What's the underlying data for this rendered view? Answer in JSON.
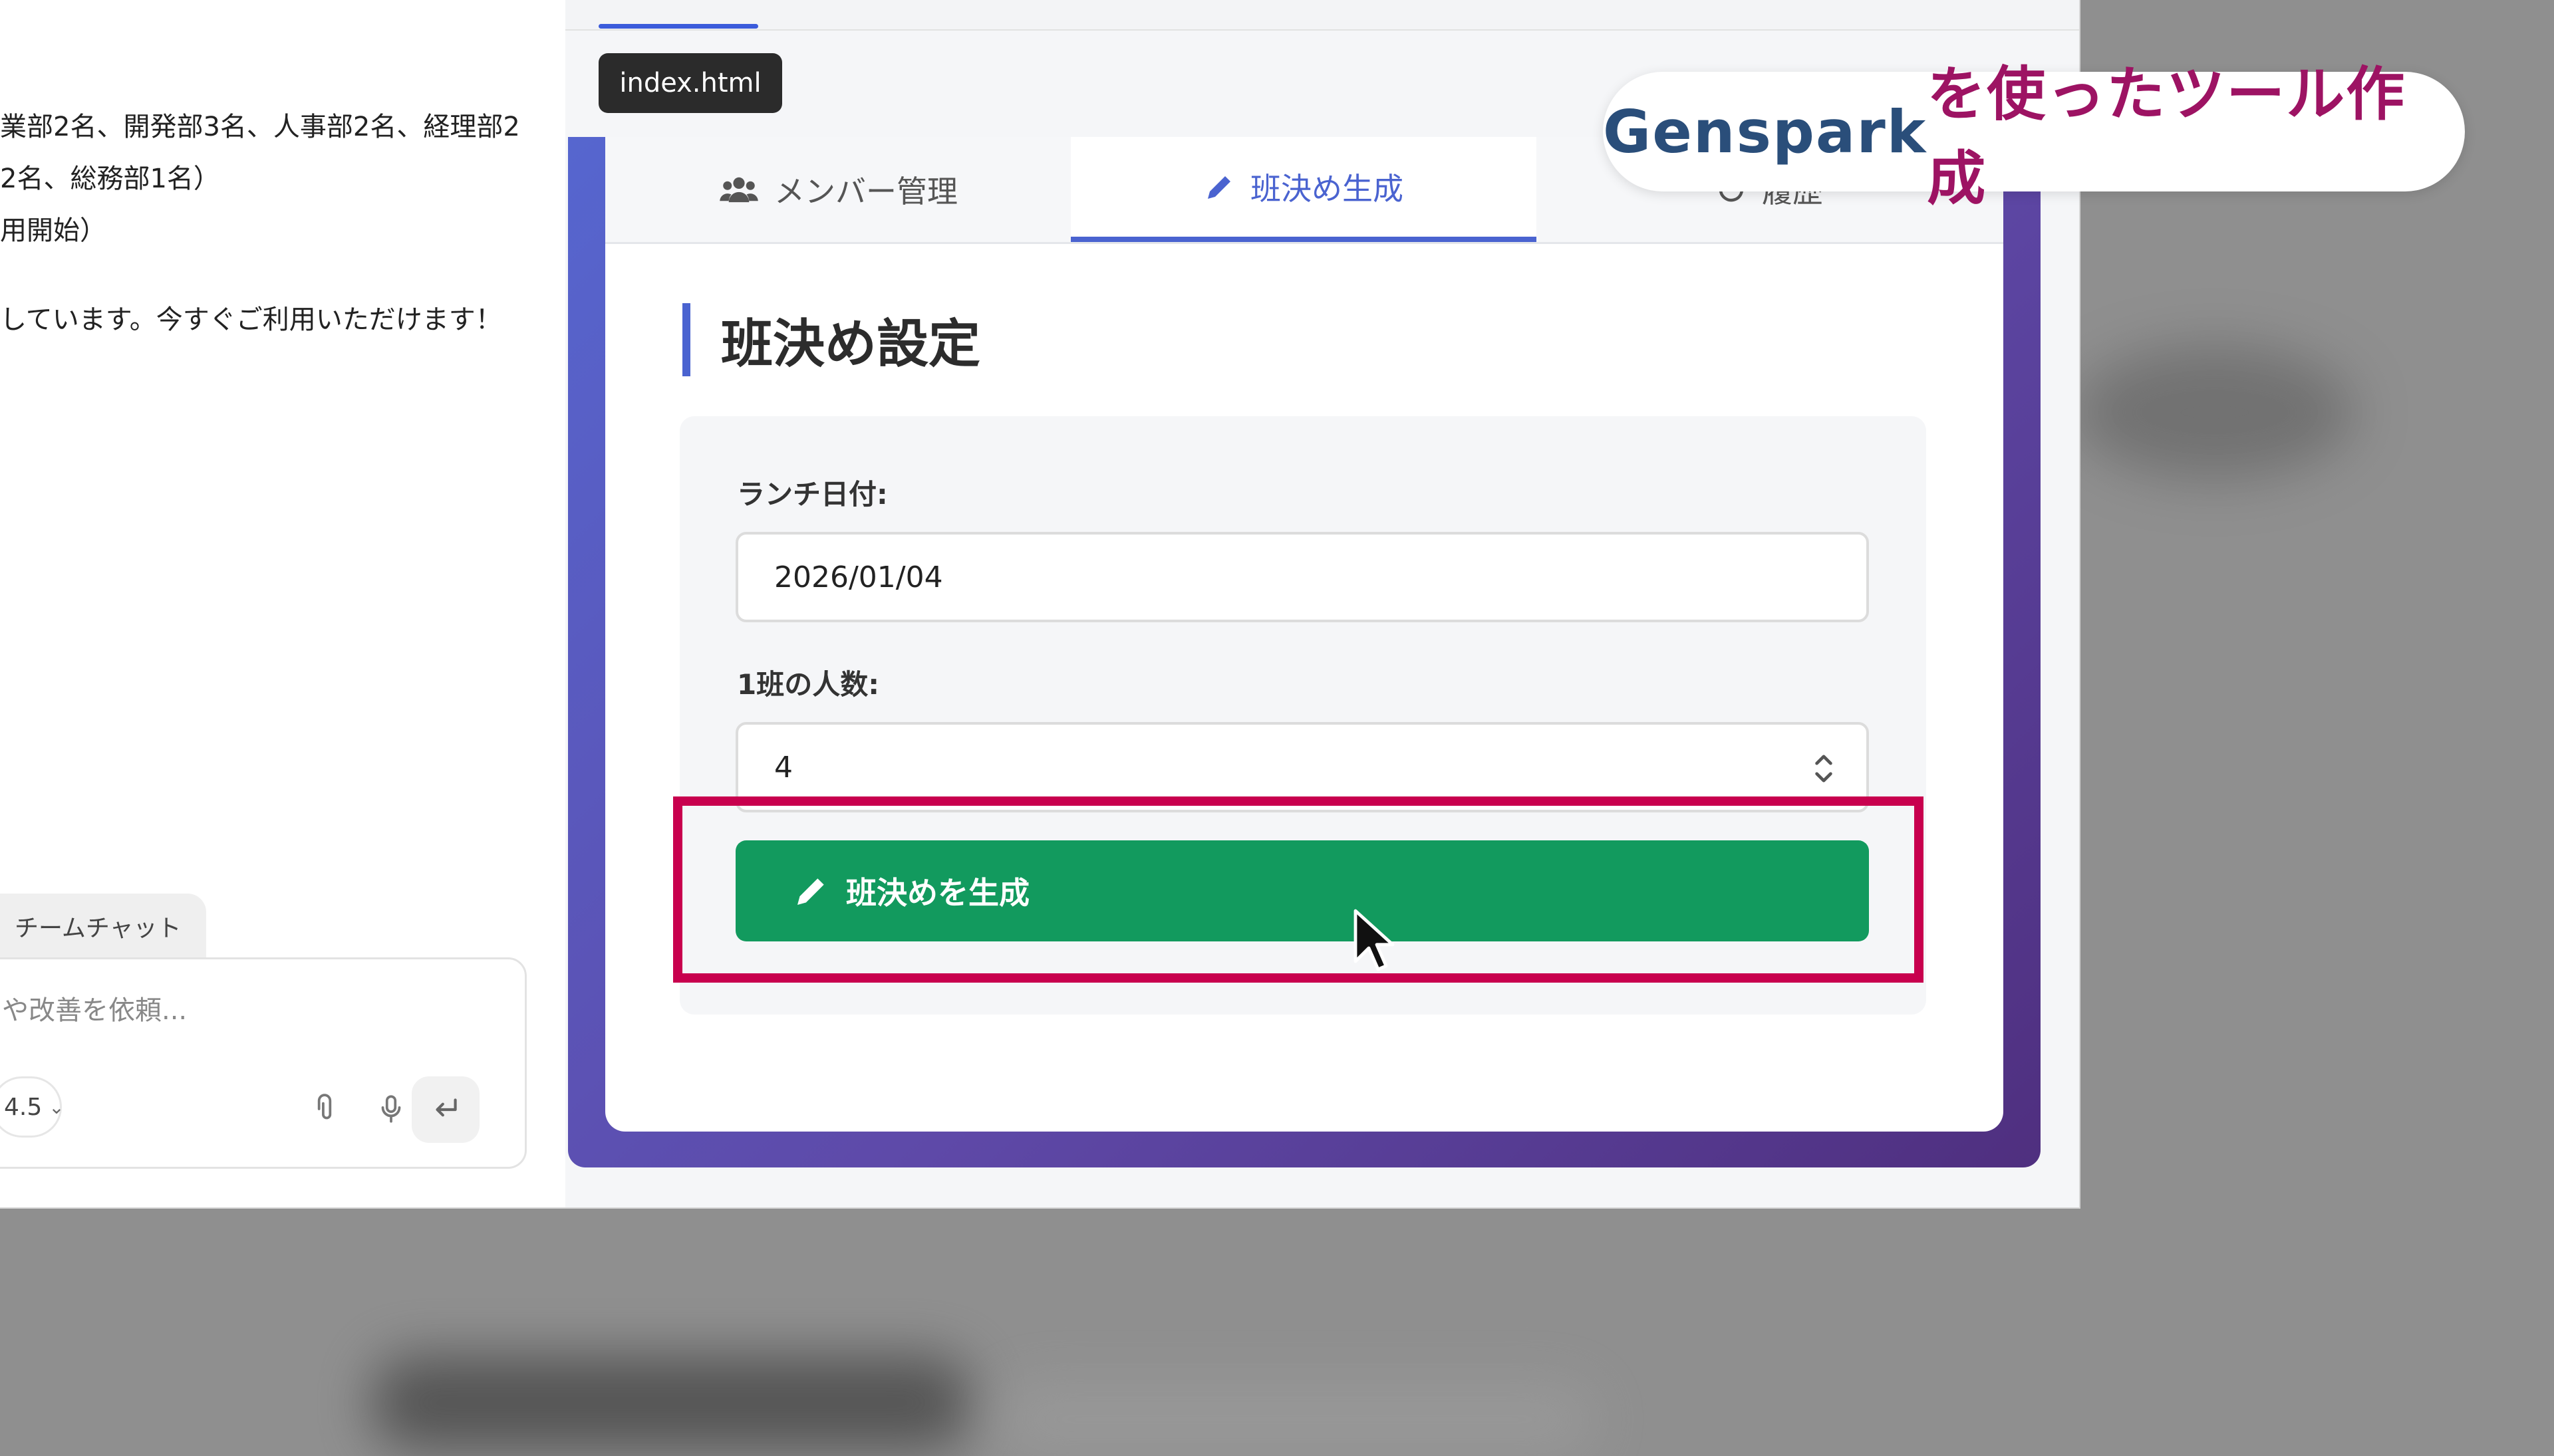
{
  "chat": {
    "lines": [
      "業部2名、開発部3名、人事部2名、経理部2",
      "2名、総務部1名）",
      "用開始）",
      "しています。今すぐご利用いただけます！"
    ],
    "tab_label": "チームチャット",
    "input_placeholder": "や改善を依頼...",
    "model_label": "4.5"
  },
  "preview": {
    "file_badge": "index.html",
    "tabs": [
      {
        "label": "メンバー管理",
        "icon": "users-icon"
      },
      {
        "label": "班決め生成",
        "icon": "pencil-icon"
      },
      {
        "label": "履歴",
        "icon": "history-icon"
      }
    ],
    "section_title": "班決め設定",
    "form": {
      "date_label": "ランチ日付:",
      "date_value": "2026/01/04",
      "group_size_label": "1班の人数:",
      "group_size_value": "4"
    },
    "generate_button_label": "班決めを生成"
  },
  "caption": {
    "brand": "Genspark",
    "rest": "を使ったツール作成"
  },
  "colors": {
    "accent": "#4a63d0",
    "button": "#129a5e",
    "highlight": "#c8004e",
    "caption_brand": "#2a4e7a",
    "caption_text": "#9d1363"
  }
}
